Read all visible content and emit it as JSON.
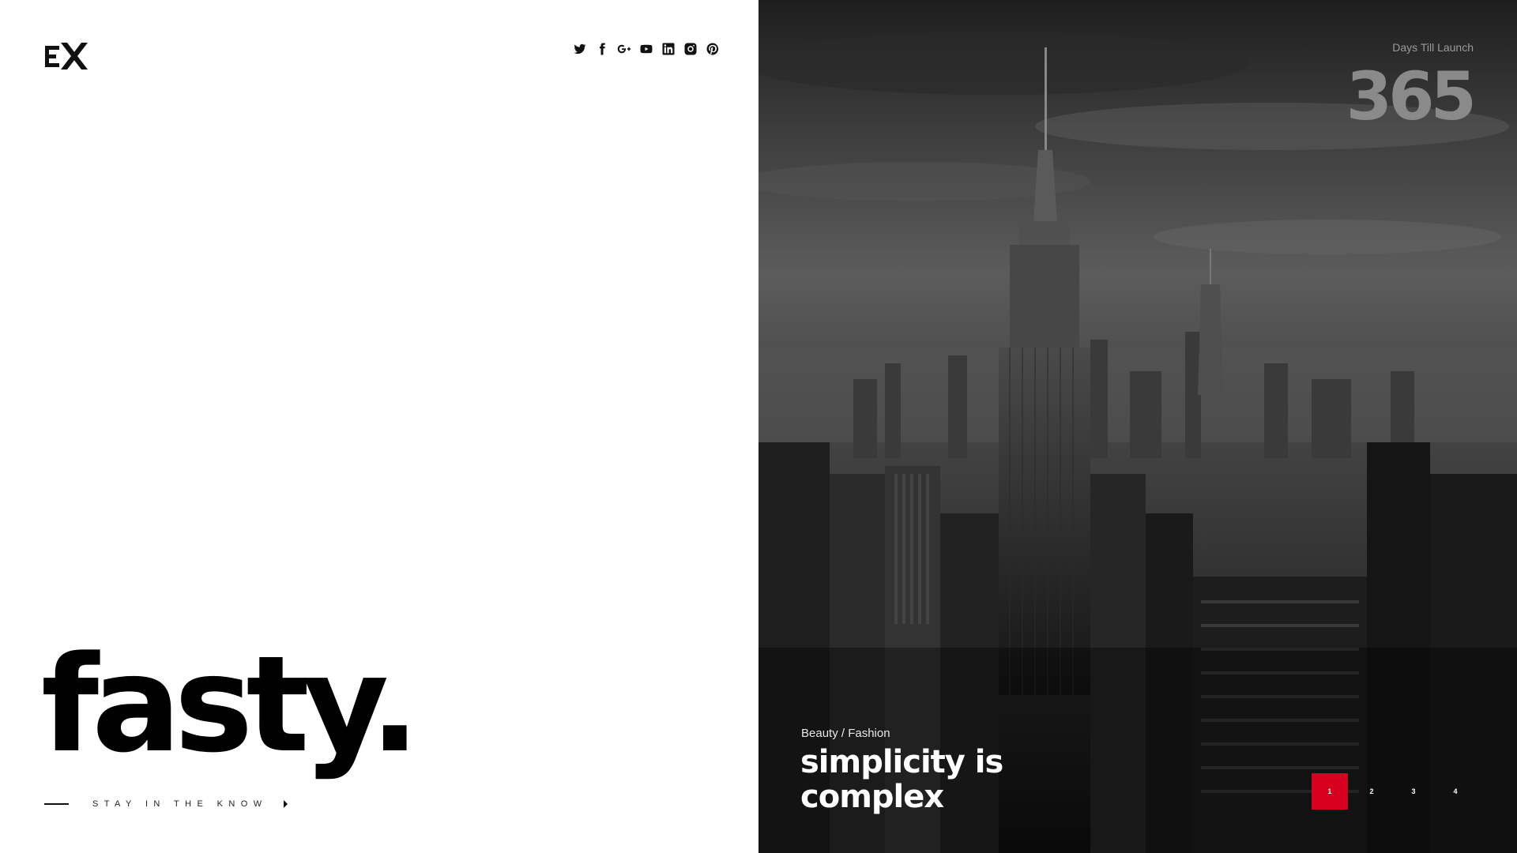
{
  "brand": {
    "name": "fasty.",
    "tagline": "STAY IN THE KNOW"
  },
  "social": [
    "twitter-icon",
    "facebook-icon",
    "google-plus-icon",
    "youtube-icon",
    "linkedin-icon",
    "instagram-icon",
    "pinterest-icon"
  ],
  "countdown": {
    "label": "Days Till Launch",
    "value": "365"
  },
  "slide": {
    "category": "Beauty / Fashion",
    "headline": "simplicity is complex"
  },
  "pagination": [
    "1",
    "2",
    "3",
    "4"
  ],
  "colors": {
    "accent": "#d8001f",
    "dark": "#000000",
    "light": "#ffffff"
  }
}
